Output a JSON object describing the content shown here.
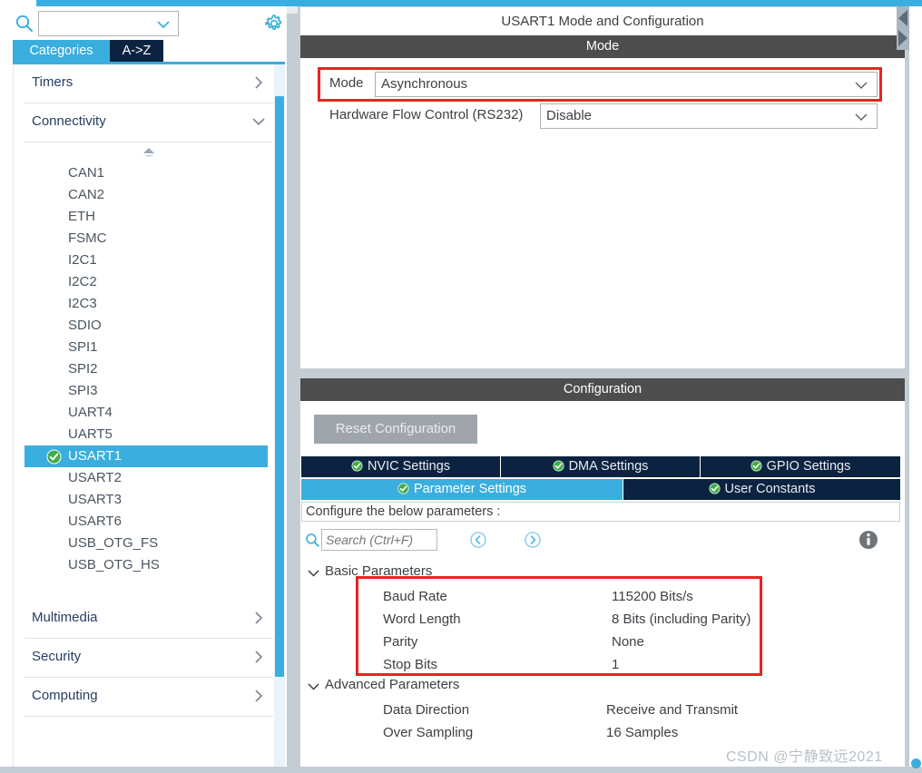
{
  "app": {
    "accent_blue": "#3aaede",
    "dark_navy": "#0b2340",
    "section_gray": "#4d4d4d",
    "highlight_red": "#ef2121",
    "watermark": "CSDN @宁静致远2021"
  },
  "sidebar": {
    "search": {
      "value": "",
      "placeholder": "",
      "icon": "search-icon"
    },
    "gear": {
      "icon": "gear-icon"
    },
    "tabs": [
      {
        "label": "Categories",
        "active": true
      },
      {
        "label": "A->Z",
        "active": false
      }
    ],
    "categories": [
      {
        "label": "Timers",
        "expanded": false,
        "arrow": "chevron-right-icon"
      },
      {
        "label": "Connectivity",
        "expanded": true,
        "arrow": "chevron-down-icon"
      },
      {
        "label": "Multimedia",
        "expanded": false,
        "arrow": "chevron-right-icon"
      },
      {
        "label": "Security",
        "expanded": false,
        "arrow": "chevron-right-icon"
      },
      {
        "label": "Computing",
        "expanded": false,
        "arrow": "chevron-right-icon"
      }
    ],
    "peripherals": [
      {
        "label": "CAN1",
        "selected": false,
        "configured": false
      },
      {
        "label": "CAN2",
        "selected": false,
        "configured": false
      },
      {
        "label": "ETH",
        "selected": false,
        "configured": false
      },
      {
        "label": "FSMC",
        "selected": false,
        "configured": false
      },
      {
        "label": "I2C1",
        "selected": false,
        "configured": false
      },
      {
        "label": "I2C2",
        "selected": false,
        "configured": false
      },
      {
        "label": "I2C3",
        "selected": false,
        "configured": false
      },
      {
        "label": "SDIO",
        "selected": false,
        "configured": false
      },
      {
        "label": "SPI1",
        "selected": false,
        "configured": false
      },
      {
        "label": "SPI2",
        "selected": false,
        "configured": false
      },
      {
        "label": "SPI3",
        "selected": false,
        "configured": false
      },
      {
        "label": "UART4",
        "selected": false,
        "configured": false
      },
      {
        "label": "UART5",
        "selected": false,
        "configured": false
      },
      {
        "label": "USART1",
        "selected": true,
        "configured": true
      },
      {
        "label": "USART2",
        "selected": false,
        "configured": false
      },
      {
        "label": "USART3",
        "selected": false,
        "configured": false
      },
      {
        "label": "USART6",
        "selected": false,
        "configured": false
      },
      {
        "label": "USB_OTG_FS",
        "selected": false,
        "configured": false
      },
      {
        "label": "USB_OTG_HS",
        "selected": false,
        "configured": false
      }
    ]
  },
  "main": {
    "title": "USART1 Mode and Configuration",
    "mode_section": {
      "header": "Mode",
      "rows": [
        {
          "label": "Mode",
          "value": "Asynchronous",
          "highlighted": true
        },
        {
          "label": "Hardware Flow Control (RS232)",
          "value": "Disable",
          "highlighted": false
        }
      ]
    },
    "configuration_section": {
      "header": "Configuration",
      "reset_button": "Reset Configuration",
      "tabs_row1": [
        {
          "label": "NVIC Settings",
          "active": false,
          "check": true
        },
        {
          "label": "DMA Settings",
          "active": false,
          "check": true
        },
        {
          "label": "GPIO Settings",
          "active": false,
          "check": true
        }
      ],
      "tabs_row2": [
        {
          "label": "Parameter Settings",
          "active": true,
          "check": true
        },
        {
          "label": "User Constants",
          "active": false,
          "check": true
        }
      ],
      "configure_hint": "Configure the below parameters :",
      "param_search": {
        "placeholder": "Search (Ctrl+F)",
        "value": ""
      },
      "nav_prev": "prev-match-icon",
      "nav_next": "next-match-icon",
      "info": "info-icon",
      "groups": [
        {
          "name": "Basic Parameters",
          "expanded": true,
          "highlighted": true,
          "params": [
            {
              "name": "Baud Rate",
              "value": "115200 Bits/s"
            },
            {
              "name": "Word Length",
              "value": "8 Bits (including Parity)"
            },
            {
              "name": "Parity",
              "value": "None"
            },
            {
              "name": "Stop Bits",
              "value": "1"
            }
          ]
        },
        {
          "name": "Advanced Parameters",
          "expanded": true,
          "highlighted": false,
          "params": [
            {
              "name": "Data Direction",
              "value": "Receive and Transmit"
            },
            {
              "name": "Over Sampling",
              "value": "16 Samples"
            }
          ]
        }
      ]
    }
  }
}
